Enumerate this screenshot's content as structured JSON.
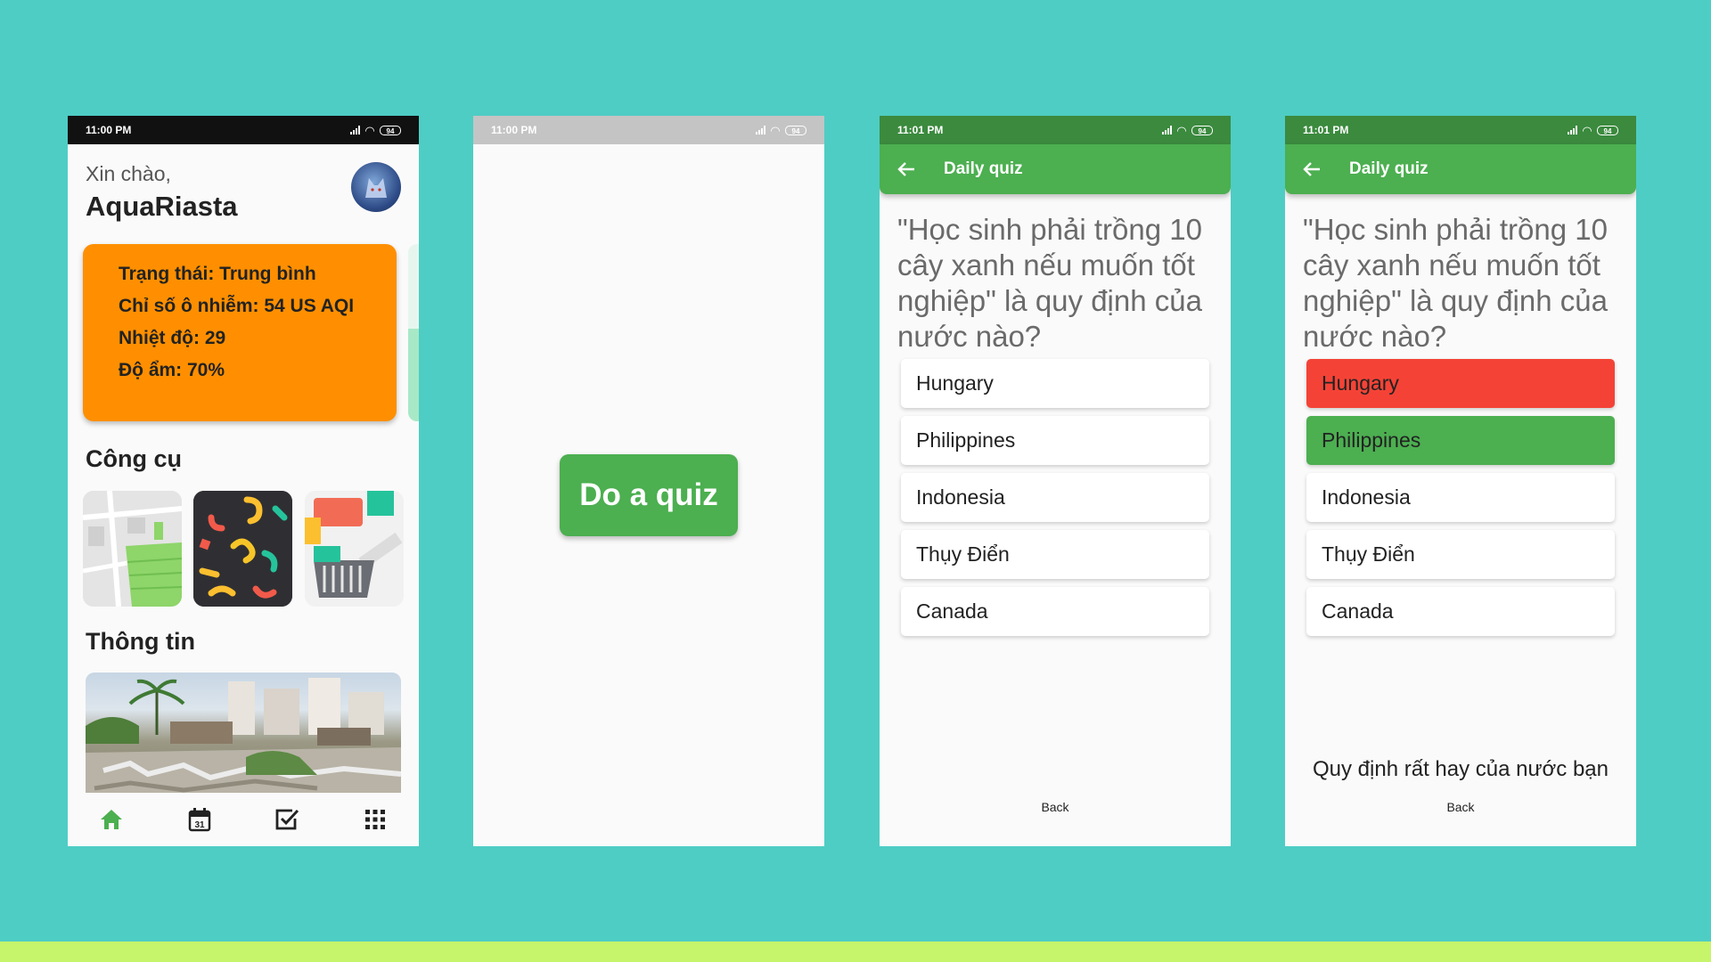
{
  "status": {
    "time_1": "11:00 PM",
    "time_2": "11:00 PM",
    "time_3": "11:01 PM",
    "time_4": "11:01 PM",
    "battery": "94"
  },
  "home": {
    "greeting": "Xin chào,",
    "username": "AquaRiasta",
    "aqi": {
      "status": "Trạng thái: Trung bình",
      "index": "Chỉ số ô nhiễm: 54 US AQI",
      "temp": "Nhiệt độ: 29",
      "humidity": "Độ ẩm: 70%"
    },
    "tools_title": "Công cụ",
    "info_title": "Thông tin",
    "calendar_day": "31",
    "nav_icons": [
      "home-icon",
      "calendar-icon",
      "task-check-icon",
      "apps-grid-icon"
    ]
  },
  "start": {
    "button": "Do a quiz"
  },
  "quiz": {
    "title": "Daily quiz",
    "question": "\"Học sinh phải trồng 10 cây xanh nếu muốn tốt nghiệp\" là quy định của nước nào?",
    "options": [
      "Hungary",
      "Philippines",
      "Indonesia",
      "Thụy Điển",
      "Canada"
    ],
    "feedback": "Quy định rất hay của nước bạn",
    "back": "Back"
  },
  "colors": {
    "background": "#4ecdc4",
    "accent_strip": "#c6f46a",
    "primary_green": "#4caf50",
    "dark_green": "#3b8a3e",
    "aqi_orange": "#ff8f00",
    "wrong_red": "#f44336"
  }
}
